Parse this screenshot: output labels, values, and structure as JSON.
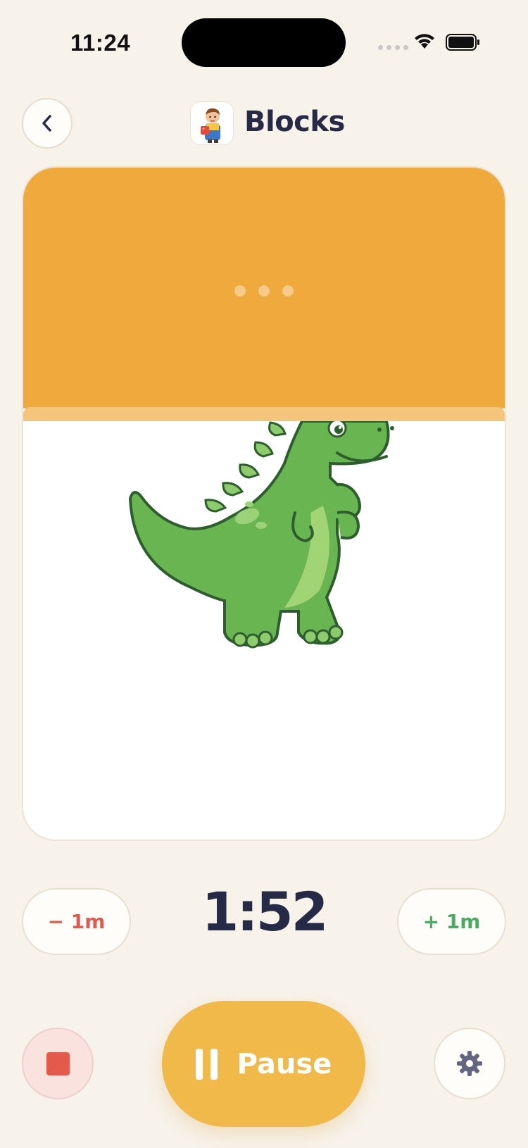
{
  "status_bar": {
    "time": "11:24"
  },
  "header": {
    "title": "Blocks",
    "app_icon": "boy-with-block-icon"
  },
  "card": {
    "image": "green-dinosaur",
    "colors": {
      "top": "#f0a93c",
      "stripe": "#f4c57a"
    }
  },
  "timer": {
    "value": "1:52",
    "minus_label": "− 1m",
    "plus_label": "+ 1m"
  },
  "controls": {
    "pause_label": "Pause"
  },
  "colors": {
    "accent": "#f1b84a",
    "stop": "#e35a4b",
    "text": "#262a47",
    "plus": "#4caa62",
    "minus": "#e05a4e"
  }
}
